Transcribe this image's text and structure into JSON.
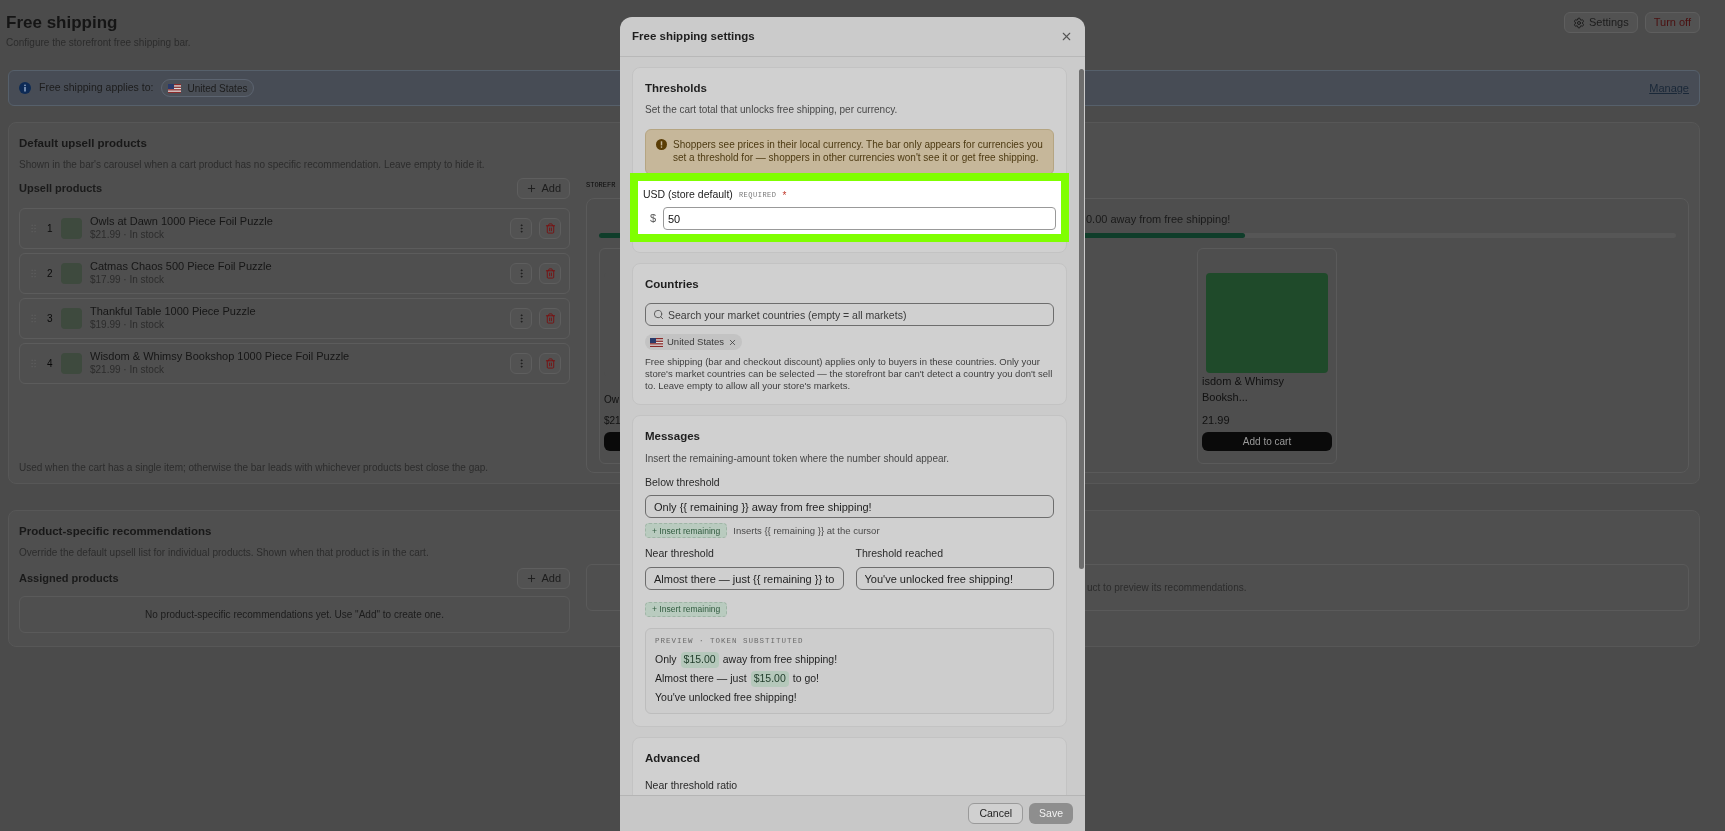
{
  "page": {
    "title": "Free shipping",
    "subtitle": "Configure the storefront free shipping bar.",
    "actions": [
      {
        "kind": "settings",
        "label": "Settings"
      },
      {
        "kind": "danger",
        "label": "Turn off"
      }
    ]
  },
  "banner": {
    "label": "Free shipping applies to:",
    "country": "United States",
    "link": "Manage"
  },
  "default_upsell": {
    "title": "Default upsell products",
    "description": "Shown in the bar's carousel when a cart product has no specific recommendation. Leave empty to hide it.",
    "list_title": "Upsell products",
    "add_label": "Add",
    "products": [
      {
        "index": "1",
        "name": "Owls at Dawn 1000 Piece Foil Puzzle",
        "meta": "$21.99 · In stock"
      },
      {
        "index": "2",
        "name": "Catmas Chaos 500 Piece Foil Puzzle",
        "meta": "$17.99 · In stock"
      },
      {
        "index": "3",
        "name": "Thankful Table 1000 Piece Puzzle",
        "meta": "$19.99 · In stock"
      },
      {
        "index": "4",
        "name": "Wisdom & Whimsy Bookshop 1000 Piece Foil Puzzle",
        "meta": "$21.99 · In stock"
      }
    ],
    "note": "Used when the cart has a single item; otherwise the bar leads with whichever products best close the gap.",
    "preview": {
      "label": "STOREFR",
      "message": "0.00 away from free shipping!",
      "level": 0.6,
      "cards": [
        {
          "name": "Ow",
          "price": "$21"
        },
        {
          "name": "isdom & Whimsy Booksh...",
          "price": "21.99",
          "button": "Add to cart"
        }
      ]
    }
  },
  "product_specific": {
    "title": "Product-specific recommendations",
    "description": "Override the default upsell list for individual products. Shown when that product is in the cart.",
    "list_title": "Assigned products",
    "add_label": "Add",
    "empty": "No product-specific recommendations yet. Use \"Add\" to create one.",
    "preview_hint": "uct to preview its recommendations."
  },
  "modal": {
    "title": "Free shipping settings",
    "thresholds": {
      "title": "Thresholds",
      "description": "Set the cart total that unlocks free shipping, per currency.",
      "warning": "Shoppers see prices in their local currency. The bar only appears for currencies you set a threshold for — shoppers in other currencies won't see it or get free shipping.",
      "field": {
        "label": "USD (store default)",
        "tag": "REQUIRED",
        "required_mark": "*",
        "prefix": "$",
        "value": "50"
      }
    },
    "countries": {
      "title": "Countries",
      "placeholder": "Search your market countries (empty = all markets)",
      "chips": [
        "United States"
      ],
      "help": "Free shipping (bar and checkout discount) applies only to buyers in these countries. Only your store's market countries can be selected — the storefront bar can't detect a country you don't sell to. Leave empty to allow all your store's markets."
    },
    "messages": {
      "title": "Messages",
      "description": "Insert the remaining-amount token where the number should appear.",
      "below": {
        "label": "Below threshold",
        "value": "Only {{ remaining }} away from free shipping!",
        "insert": "+ Insert remaining",
        "hint": "Inserts {{ remaining }} at the cursor"
      },
      "near": {
        "label": "Near threshold",
        "value": "Almost there — just {{ remaining }} to",
        "insert": "+ Insert remaining"
      },
      "reached": {
        "label": "Threshold reached",
        "value": "You've unlocked free shipping!"
      },
      "preview": {
        "label": "PREVIEW · TOKEN SUBSTITUTED",
        "lines": [
          [
            {
              "text": "Only",
              "token": false
            },
            {
              "text": "$15.00",
              "token": true
            },
            {
              "text": "away from free shipping!",
              "token": false
            }
          ],
          [
            {
              "text": "Almost there — just",
              "token": false
            },
            {
              "text": "$15.00",
              "token": true
            },
            {
              "text": "to go!",
              "token": false
            }
          ],
          [
            {
              "text": "You've unlocked free shipping!",
              "token": false
            }
          ]
        ]
      }
    },
    "advanced": {
      "title": "Advanced",
      "field_label": "Near threshold ratio"
    },
    "footer": {
      "cancel": "Cancel",
      "save": "Save",
      "save_disabled": true
    }
  }
}
